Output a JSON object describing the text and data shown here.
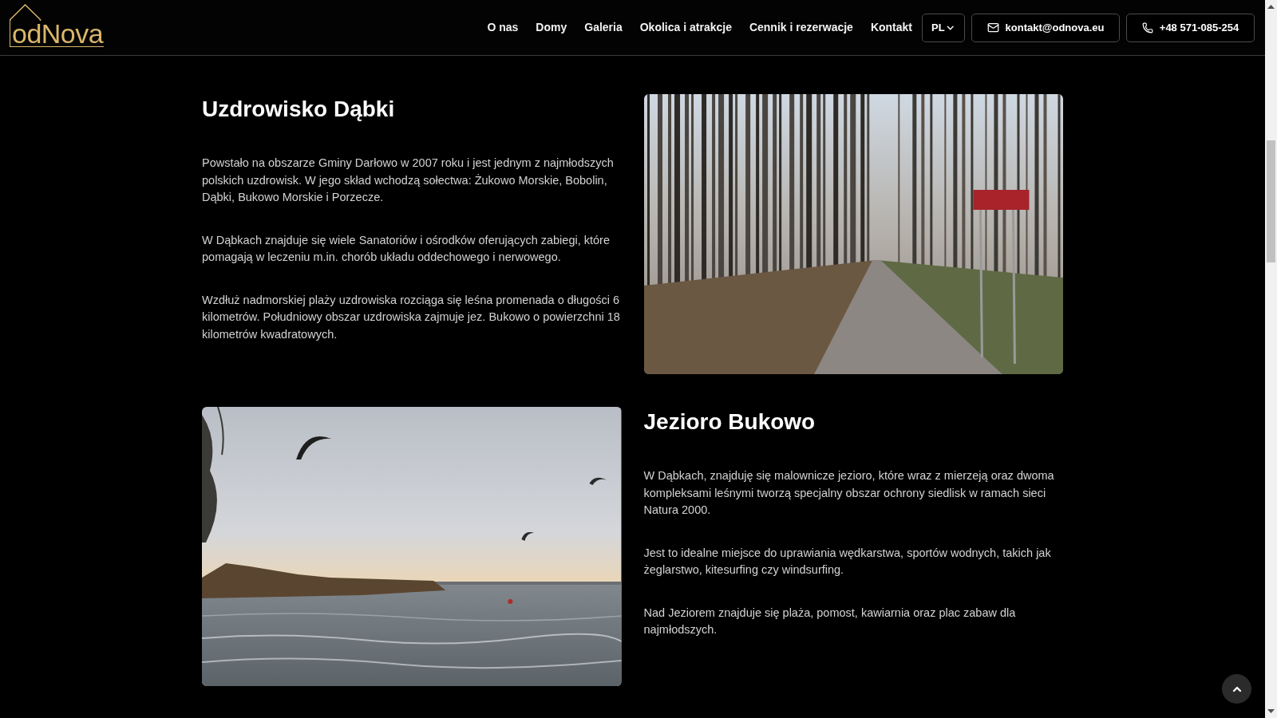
{
  "header": {
    "logo": "odNova",
    "nav": [
      {
        "label": "O nas"
      },
      {
        "label": "Domy"
      },
      {
        "label": "Galeria"
      },
      {
        "label": "Okolica i atrakcje"
      },
      {
        "label": "Cennik i rezerwacje"
      },
      {
        "label": "Kontakt"
      }
    ],
    "language": "PL",
    "email": "kontakt@odnova.eu",
    "phone": "+48 571-085-254"
  },
  "sections": [
    {
      "title": "Uzdrowisko Dąbki",
      "kind": "forest",
      "paragraphs": [
        "Powstało na obszarze Gminy Darłowo w 2007 roku i jest jednym z najmłodszych polskich uzdrowisk. W jego skład wchodzą sołectwa: Żukowo Morskie, Bobolin, Dąbki, Bukowo Morskie i Porzecze.",
        "W Dąbkach znajduje się wiele Sanatoriów i ośrodków oferujących zabiegi, które pomagają w leczeniu m.in. chorób układu oddechowego i nerwowego.",
        "Wzdłuż nadmorskiej plaży uzdrowiska rozciąga się leśna promenada o długości 6 kilometrów. Południowy obszar uzdrowiska zajmuje jez. Bukowo o powierzchni 18 kilometrów kwadratowych."
      ]
    },
    {
      "title": "Jezioro Bukowo",
      "kind": "lake",
      "paragraphs": [
        "W Dąbkach, znajduję się malownicze jezioro, które wraz z mierzeją oraz dwoma kompleksami leśnymi tworzą specjalny obszar ochrony siedlisk w ramach sieci Natura 2000.",
        "Jest to idealne miejsce do uprawiania wędkarstwa, sportów wodnych, takich jak żeglarstwo, kitesurfing czy windsurfing.",
        "Nad Jeziorem znajduje się plaża, pomost, kawiarnia oraz plac zabaw dla najmłodszych."
      ]
    }
  ]
}
